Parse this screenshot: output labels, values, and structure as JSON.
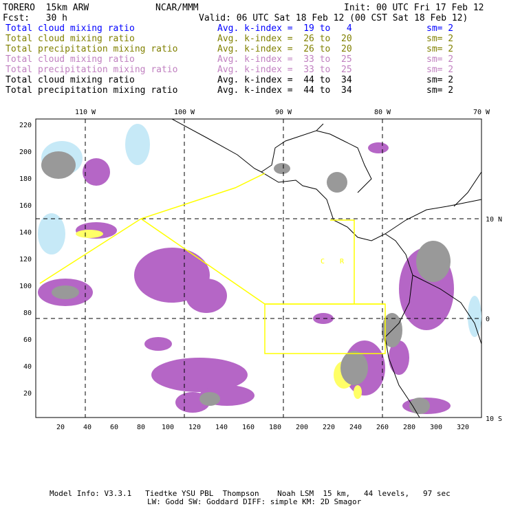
{
  "header": {
    "model": "TORERO  15km ARW",
    "org": "NCAR/MMM",
    "init": "Init: 00 UTC Fri 17 Feb 12",
    "fcst": "Fcst:   30 h",
    "valid": "Valid: 06 UTC Sat 18 Feb 12 (00 CST Sat 18 Feb 12)"
  },
  "legend": [
    {
      "field": "Total cloud mixing ratio",
      "range": "Avg. k-index =  19 to   4",
      "sm": "sm= 2",
      "color": "#0000ff"
    },
    {
      "field": "Total cloud mixing ratio",
      "range": "Avg. k-index =  26 to  20",
      "sm": "sm= 2",
      "color": "#808000"
    },
    {
      "field": "Total precipitation mixing ratio",
      "range": "Avg. k-index =  26 to  20",
      "sm": "sm= 2",
      "color": "#808000"
    },
    {
      "field": "Total cloud mixing ratio",
      "range": "Avg. k-index =  33 to  25",
      "sm": "sm= 2",
      "color": "#c080c0"
    },
    {
      "field": "Total precipitation mixing ratio",
      "range": "Avg. k-index =  33 to  25",
      "sm": "sm= 2",
      "color": "#c080c0"
    },
    {
      "field": "Total cloud mixing ratio",
      "range": "Avg. k-index =  44 to  34",
      "sm": "sm= 2",
      "color": "#000000"
    },
    {
      "field": "Total precipitation mixing ratio",
      "range": "Avg. k-index =  44 to  34",
      "sm": "sm= 2",
      "color": "#000000"
    }
  ],
  "axes": {
    "top": [
      "110 W",
      "100 W",
      "90 W",
      "80 W",
      "70 W"
    ],
    "right": [
      "10 N",
      "0",
      "10 S"
    ],
    "bottom": [
      "20",
      "40",
      "60",
      "80",
      "100",
      "120",
      "140",
      "160",
      "180",
      "200",
      "220",
      "240",
      "260",
      "280",
      "300",
      "320"
    ],
    "left": [
      "20",
      "40",
      "60",
      "80",
      "100",
      "120",
      "140",
      "160",
      "180",
      "200",
      "220"
    ]
  },
  "map_labels": {
    "c": "C",
    "r": "R"
  },
  "footer": {
    "line1": "Model Info: V3.3.1   Tiedtke YSU PBL  Thompson    Noah LSM  15 km,   44 levels,   97 sec",
    "line2": "LW: Godd SW: Goddard DIFF: simple KM: 2D Smagor"
  }
}
